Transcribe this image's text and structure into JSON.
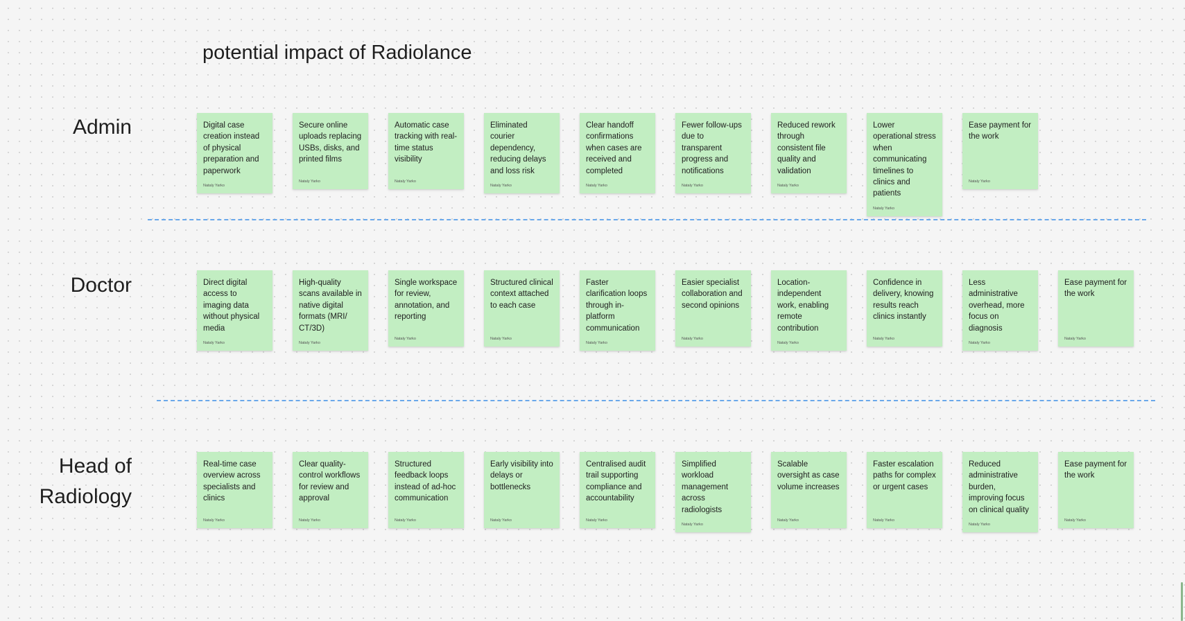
{
  "board": {
    "title": "potential impact of Radiolance"
  },
  "rows": {
    "admin": {
      "label": "Admin",
      "notes": [
        {
          "text": "Digital case creation instead of physical preparation and paperwork",
          "author": "Nataly Yarko"
        },
        {
          "text": "Secure online uploads replacing USBs, disks, and printed films",
          "author": "Nataly Yarko"
        },
        {
          "text": "Automatic case tracking with real-time status visibility",
          "author": "Nataly Yarko"
        },
        {
          "text": "Eliminated courier dependency, reducing delays and loss risk",
          "author": "Nataly Yarko"
        },
        {
          "text": "Clear handoff confirmations when cases are received and completed",
          "author": "Nataly Yarko"
        },
        {
          "text": "Fewer follow-ups due to transparent progress and notifications",
          "author": "Nataly Yarko"
        },
        {
          "text": "Reduced rework through consistent file quality and validation",
          "author": "Nataly Yarko"
        },
        {
          "text": "Lower operational stress when communicating timelines to clinics and patients",
          "author": "Nataly Yarko"
        },
        {
          "text": "Ease payment for the work",
          "author": "Nataly Yarko"
        }
      ]
    },
    "doctor": {
      "label": "Doctor",
      "notes": [
        {
          "text": "Direct digital access to imaging data without physical media",
          "author": "Nataly Yarko"
        },
        {
          "text": "High-quality scans available in native digital formats (MRI/ CT/3D)",
          "author": "Nataly Yarko"
        },
        {
          "text": "Single workspace for review, annotation, and reporting",
          "author": "Nataly Yarko"
        },
        {
          "text": "Structured clinical context attached to each case",
          "author": "Nataly Yarko"
        },
        {
          "text": "Faster clarification loops through in-platform communication",
          "author": "Nataly Yarko"
        },
        {
          "text": "Easier specialist collaboration and second opinions",
          "author": "Nataly Yarko"
        },
        {
          "text": "Location-independent work, enabling remote contribution",
          "author": "Nataly Yarko"
        },
        {
          "text": "Confidence in delivery, knowing results reach clinics instantly",
          "author": "Nataly Yarko"
        },
        {
          "text": "Less administrative overhead, more focus on diagnosis",
          "author": "Nataly Yarko"
        },
        {
          "text": "Ease payment for the work",
          "author": "Nataly Yarko"
        }
      ]
    },
    "head": {
      "label": "Head of Radiology",
      "notes": [
        {
          "text": "Real-time case overview across specialists and clinics",
          "author": "Nataly Yarko"
        },
        {
          "text": "Clear quality-control workflows for review and approval",
          "author": "Nataly Yarko"
        },
        {
          "text": "Structured feedback loops instead of ad-hoc communication",
          "author": "Nataly Yarko"
        },
        {
          "text": "Early visibility into delays or bottlenecks",
          "author": "Nataly Yarko"
        },
        {
          "text": "Centralised audit trail supporting compliance and accountability",
          "author": "Nataly Yarko"
        },
        {
          "text": "Simplified workload management across radiologists",
          "author": "Nataly Yarko"
        },
        {
          "text": "Scalable oversight as case volume increases",
          "author": "Nataly Yarko"
        },
        {
          "text": "Faster escalation paths for complex or urgent cases",
          "author": "Nataly Yarko"
        },
        {
          "text": "Reduced administrative burden, improving focus on clinical quality",
          "author": "Nataly Yarko"
        },
        {
          "text": "Ease payment for the work",
          "author": "Nataly Yarko"
        }
      ]
    }
  },
  "colors": {
    "sticky": "#c2eec2",
    "divider": "#6aa8ea",
    "canvas": "#f5f5f5"
  }
}
